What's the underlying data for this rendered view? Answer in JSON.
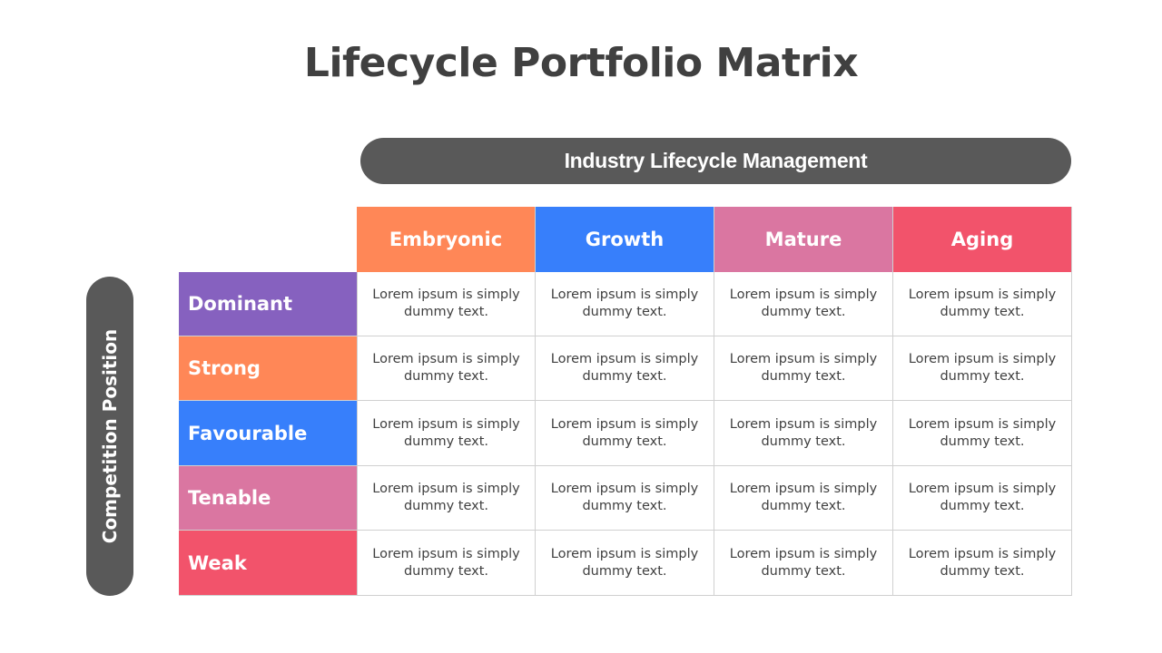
{
  "title": "Lifecycle Portfolio Matrix",
  "column_axis_label": "Industry Lifecycle Management",
  "row_axis_label": "Competition Position",
  "columns": [
    {
      "label": "Embryonic",
      "color": "#FF8757"
    },
    {
      "label": "Growth",
      "color": "#377FFB"
    },
    {
      "label": "Mature",
      "color": "#DA76A1"
    },
    {
      "label": "Aging",
      "color": "#F2536B"
    }
  ],
  "rows": [
    {
      "label": "Dominant",
      "color": "#8661BF",
      "cells": [
        "Lorem ipsum is simply dummy text.",
        "Lorem ipsum is simply dummy text.",
        "Lorem ipsum is simply dummy text.",
        "Lorem ipsum is simply dummy text."
      ]
    },
    {
      "label": "Strong",
      "color": "#FF8757",
      "cells": [
        "Lorem ipsum is simply dummy text.",
        "Lorem ipsum is simply dummy text.",
        "Lorem ipsum is simply dummy text.",
        "Lorem ipsum is simply dummy text."
      ]
    },
    {
      "label": "Favourable",
      "color": "#377FFB",
      "cells": [
        "Lorem ipsum is simply dummy text.",
        "Lorem ipsum is simply dummy text.",
        "Lorem ipsum is simply dummy text.",
        "Lorem ipsum is simply dummy text."
      ]
    },
    {
      "label": "Tenable",
      "color": "#DA76A1",
      "cells": [
        "Lorem ipsum is simply dummy text.",
        "Lorem ipsum is simply dummy text.",
        "Lorem ipsum is simply dummy text.",
        "Lorem ipsum is simply dummy text."
      ]
    },
    {
      "label": "Weak",
      "color": "#F2536B",
      "cells": [
        "Lorem ipsum is simply dummy text.",
        "Lorem ipsum is simply dummy text.",
        "Lorem ipsum is simply dummy text.",
        "Lorem ipsum is simply dummy text."
      ]
    }
  ]
}
